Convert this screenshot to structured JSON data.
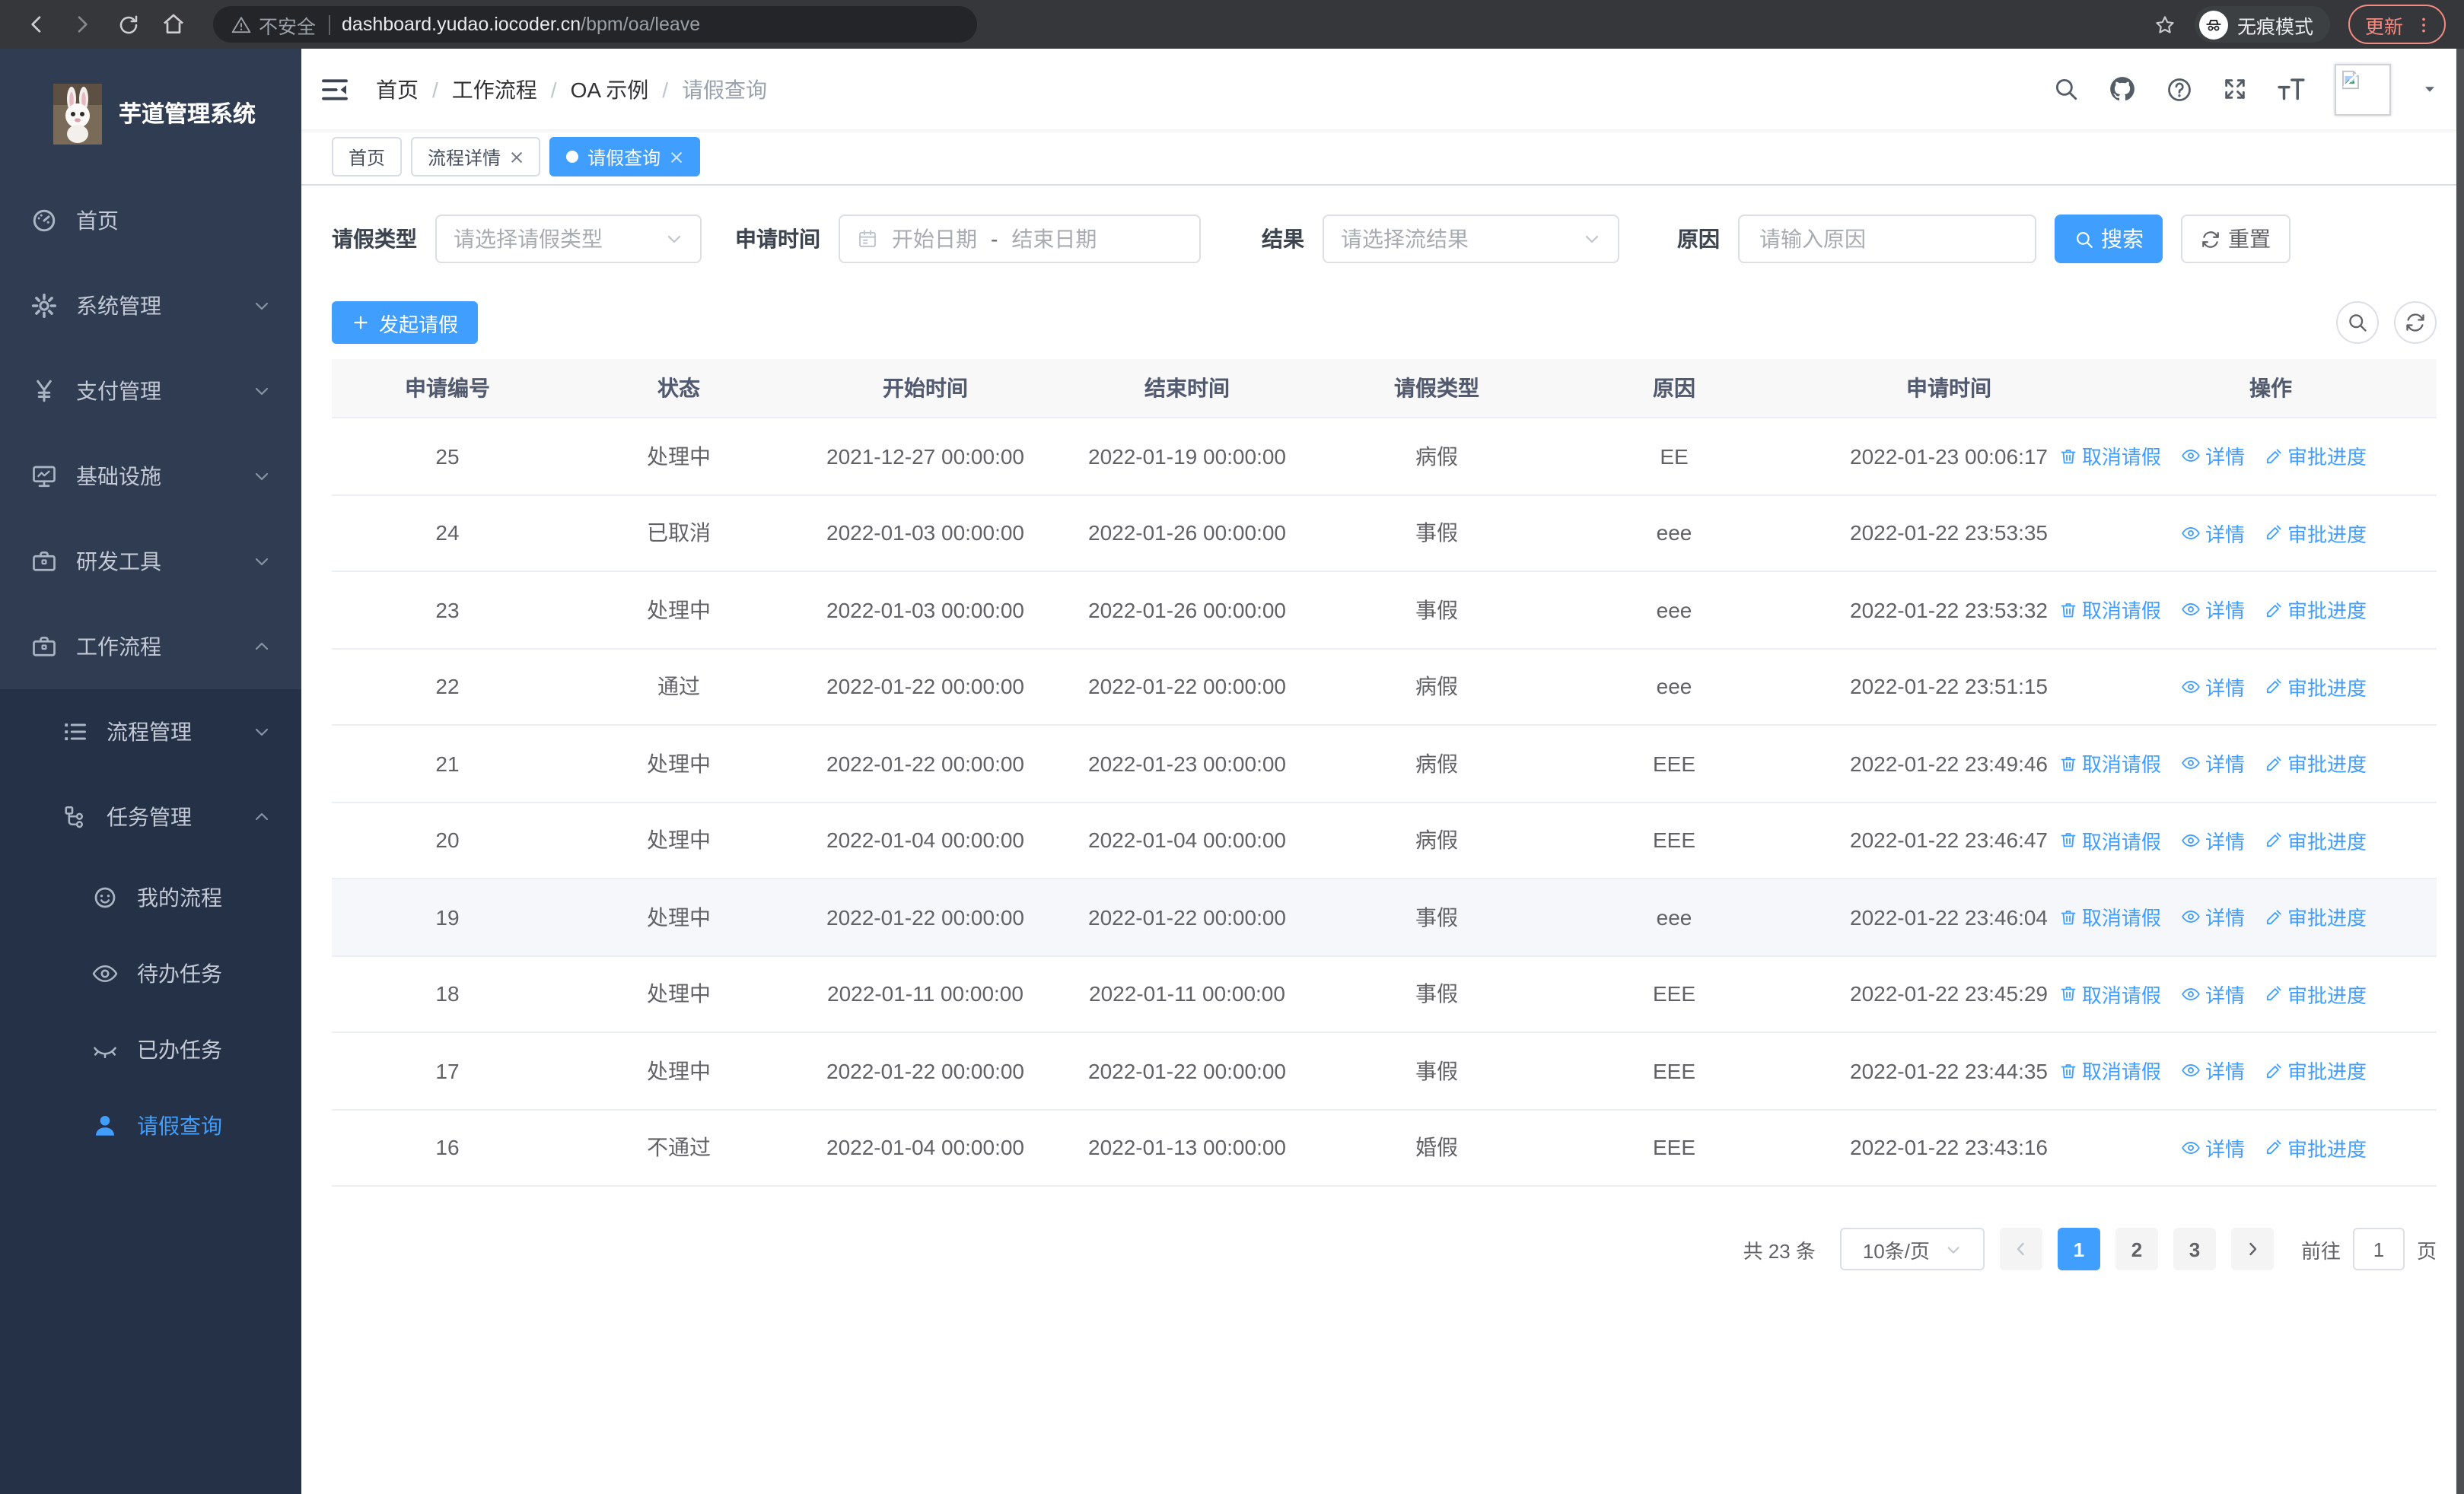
{
  "browser": {
    "security_label": "不安全",
    "url_host": "dashboard.yudao.iocoder.cn",
    "url_path": "/bpm/oa/leave",
    "incognito_label": "无痕模式",
    "update_label": "更新"
  },
  "sidebar": {
    "title": "芋道管理系统",
    "items": [
      {
        "label": "首页",
        "icon": "dashboard-icon",
        "level": 1
      },
      {
        "label": "系统管理",
        "icon": "gear-icon",
        "level": 1,
        "arrow": "down"
      },
      {
        "label": "支付管理",
        "icon": "yen-icon",
        "level": 1,
        "arrow": "down"
      },
      {
        "label": "基础设施",
        "icon": "monitor-icon",
        "level": 1,
        "arrow": "down"
      },
      {
        "label": "研发工具",
        "icon": "briefcase-icon",
        "level": 1,
        "arrow": "down"
      },
      {
        "label": "工作流程",
        "icon": "briefcase-icon",
        "level": 1,
        "arrow": "up"
      },
      {
        "label": "流程管理",
        "icon": "list-icon",
        "level": 2,
        "arrow": "down"
      },
      {
        "label": "任务管理",
        "icon": "flow-icon",
        "level": 2,
        "arrow": "up"
      },
      {
        "label": "我的流程",
        "icon": "face-icon",
        "level": 3
      },
      {
        "label": "待办任务",
        "icon": "eye-icon",
        "level": 3
      },
      {
        "label": "已办任务",
        "icon": "eye-closed-icon",
        "level": 3
      },
      {
        "label": "请假查询",
        "icon": "user-icon",
        "level": 3,
        "active": true
      }
    ]
  },
  "header": {
    "breadcrumb": [
      "首页",
      "工作流程",
      "OA 示例",
      "请假查询"
    ]
  },
  "tabs": [
    {
      "label": "首页",
      "closable": false,
      "active": false
    },
    {
      "label": "流程详情",
      "closable": true,
      "active": false
    },
    {
      "label": "请假查询",
      "closable": true,
      "active": true
    }
  ],
  "filters": {
    "type_label": "请假类型",
    "type_placeholder": "请选择请假类型",
    "time_label": "申请时间",
    "time_start_placeholder": "开始日期",
    "time_separator": "-",
    "time_end_placeholder": "结束日期",
    "result_label": "结果",
    "result_placeholder": "请选择流结果",
    "reason_label": "原因",
    "reason_placeholder": "请输入原因",
    "search_label": "搜索",
    "reset_label": "重置"
  },
  "toolbar": {
    "create_label": "发起请假"
  },
  "table": {
    "headers": [
      "申请编号",
      "状态",
      "开始时间",
      "结束时间",
      "请假类型",
      "原因",
      "申请时间",
      "操作"
    ],
    "action_labels": {
      "cancel": "取消请假",
      "detail": "详情",
      "progress": "审批进度"
    },
    "rows": [
      {
        "id": "25",
        "status": "处理中",
        "start": "2021-12-27 00:00:00",
        "end": "2022-01-19 00:00:00",
        "type": "病假",
        "reason": "EE",
        "applied": "2022-01-23 00:06:17",
        "cancel": true,
        "highlight": false
      },
      {
        "id": "24",
        "status": "已取消",
        "start": "2022-01-03 00:00:00",
        "end": "2022-01-26 00:00:00",
        "type": "事假",
        "reason": "eee",
        "applied": "2022-01-22 23:53:35",
        "cancel": false,
        "highlight": false
      },
      {
        "id": "23",
        "status": "处理中",
        "start": "2022-01-03 00:00:00",
        "end": "2022-01-26 00:00:00",
        "type": "事假",
        "reason": "eee",
        "applied": "2022-01-22 23:53:32",
        "cancel": true,
        "highlight": false
      },
      {
        "id": "22",
        "status": "通过",
        "start": "2022-01-22 00:00:00",
        "end": "2022-01-22 00:00:00",
        "type": "病假",
        "reason": "eee",
        "applied": "2022-01-22 23:51:15",
        "cancel": false,
        "highlight": false
      },
      {
        "id": "21",
        "status": "处理中",
        "start": "2022-01-22 00:00:00",
        "end": "2022-01-23 00:00:00",
        "type": "病假",
        "reason": "EEE",
        "applied": "2022-01-22 23:49:46",
        "cancel": true,
        "highlight": false
      },
      {
        "id": "20",
        "status": "处理中",
        "start": "2022-01-04 00:00:00",
        "end": "2022-01-04 00:00:00",
        "type": "病假",
        "reason": "EEE",
        "applied": "2022-01-22 23:46:47",
        "cancel": true,
        "highlight": false
      },
      {
        "id": "19",
        "status": "处理中",
        "start": "2022-01-22 00:00:00",
        "end": "2022-01-22 00:00:00",
        "type": "事假",
        "reason": "eee",
        "applied": "2022-01-22 23:46:04",
        "cancel": true,
        "highlight": true
      },
      {
        "id": "18",
        "status": "处理中",
        "start": "2022-01-11 00:00:00",
        "end": "2022-01-11 00:00:00",
        "type": "事假",
        "reason": "EEE",
        "applied": "2022-01-22 23:45:29",
        "cancel": true,
        "highlight": false
      },
      {
        "id": "17",
        "status": "处理中",
        "start": "2022-01-22 00:00:00",
        "end": "2022-01-22 00:00:00",
        "type": "事假",
        "reason": "EEE",
        "applied": "2022-01-22 23:44:35",
        "cancel": true,
        "highlight": false
      },
      {
        "id": "16",
        "status": "不通过",
        "start": "2022-01-04 00:00:00",
        "end": "2022-01-13 00:00:00",
        "type": "婚假",
        "reason": "EEE",
        "applied": "2022-01-22 23:43:16",
        "cancel": false,
        "highlight": false
      }
    ]
  },
  "pagination": {
    "total_label": "共 23 条",
    "page_size": "10条/页",
    "pages": [
      "1",
      "2",
      "3"
    ],
    "active_page": "1",
    "goto_label": "前往",
    "goto_value": "1",
    "page_label": "页"
  },
  "colors": {
    "accent": "#409eff",
    "sidebar_bg": "#2f3c51",
    "sidebar_sub_bg": "#253146",
    "chrome_bg": "#36373b",
    "update_accent": "#f28b82"
  }
}
